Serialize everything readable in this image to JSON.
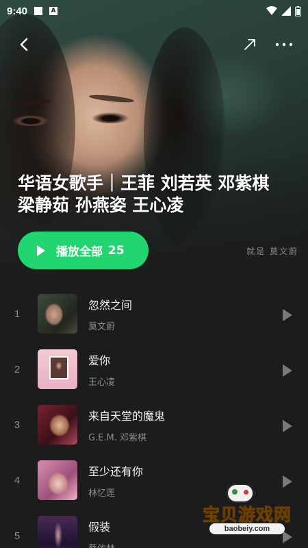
{
  "status_bar": {
    "time": "9:40",
    "notification_icon": "A"
  },
  "header": {
    "back_icon": "chevron-left-icon",
    "share_icon": "share-arrow-icon",
    "more_icon": "more-horizontal-icon",
    "cover_caption": "就是 莫文蔚"
  },
  "playlist": {
    "title": "华语女歌手｜王菲 刘若英 邓紫棋 梁静茹 孙燕姿 王心凌",
    "play_all_label": "播放全部",
    "play_all_count": "25",
    "accent_color": "#22d66f"
  },
  "songs": [
    {
      "index": "1",
      "name": "忽然之间",
      "artist": "莫文蔚"
    },
    {
      "index": "2",
      "name": "爱你",
      "artist": "王心凌"
    },
    {
      "index": "3",
      "name": "来自天堂的魔鬼",
      "artist": "G.E.M. 邓紫棋"
    },
    {
      "index": "4",
      "name": "至少还有你",
      "artist": "林忆莲"
    },
    {
      "index": "5",
      "name": "假装",
      "artist": "蔡依林"
    }
  ],
  "watermark": {
    "brand": "宝贝游戏网",
    "domain": "baobeiy.com"
  }
}
